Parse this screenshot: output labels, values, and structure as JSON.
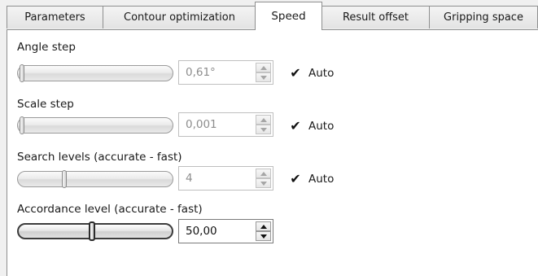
{
  "tabs": [
    {
      "label": "Parameters"
    },
    {
      "label": "Contour optimization"
    },
    {
      "label": "Speed"
    },
    {
      "label": "Result offset"
    },
    {
      "label": "Gripping space"
    }
  ],
  "active_tab": "Speed",
  "fields": {
    "angle_step": {
      "label": "Angle step",
      "slider_fraction": 0.0,
      "value": "0,61°",
      "enabled": false,
      "auto": {
        "label": "Auto",
        "checked": true
      }
    },
    "scale_step": {
      "label": "Scale step",
      "slider_fraction": 0.0,
      "value": "0,001",
      "enabled": false,
      "auto": {
        "label": "Auto",
        "checked": true
      }
    },
    "search_levels": {
      "label": "Search levels (accurate - fast)",
      "slider_fraction": 0.29,
      "value": "4",
      "enabled": false,
      "auto": {
        "label": "Auto",
        "checked": true
      }
    },
    "accordance_level": {
      "label": "Accordance level (accurate - fast)",
      "slider_fraction": 0.48,
      "value": "50,00",
      "enabled": true
    }
  },
  "icons": {
    "check": "✔"
  }
}
